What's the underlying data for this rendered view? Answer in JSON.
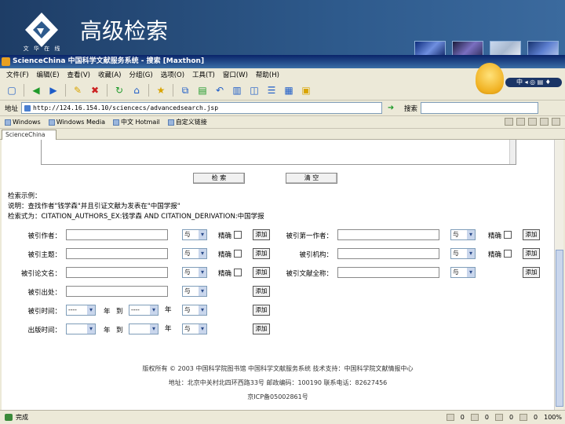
{
  "slide": {
    "title": "高级检索",
    "logo_caption": "文 华 在 线"
  },
  "browser": {
    "title": "ScienceChina 中国科学文献服务系统 - 搜索 [Maxthon]",
    "menu": [
      "文件(F)",
      "编辑(E)",
      "查看(V)",
      "收藏(A)",
      "分组(G)",
      "选项(O)",
      "工具(T)",
      "窗口(W)",
      "帮助(H)"
    ],
    "mascot_label": "中 ◂ ◎ ▤ ♦",
    "address_label": "地址",
    "address_url": "http://124.16.154.10/sciencecs/advancedsearch.jsp",
    "search_label": "搜索",
    "favorites": [
      "Windows",
      "Windows Media",
      "中文 Hotmail",
      "自定义链接"
    ],
    "tab_label": "ScienceChina"
  },
  "page": {
    "search_button": "检 索",
    "clear_button": "清 空",
    "examples_title": "检索示例：",
    "example_1": "说明：查找作者\"钱学森\"并且引证文献为发表在\"中国学报\"",
    "example_2": "检索式为：CITATION_AUTHORS_EX:钱学森 AND CITATION_DERIVATION:中国学报",
    "fields": [
      {
        "label": "被引作者：",
        "op": "与",
        "exact": "精确",
        "add": "添加"
      },
      {
        "label": "被引主题：",
        "op": "与",
        "exact": "精确",
        "add": "添加"
      },
      {
        "label": "被引论文名：",
        "op": "与",
        "exact": "精确",
        "add": "添加"
      },
      {
        "label": "被引出处：",
        "op": "与",
        "add": "添加"
      },
      {
        "label": "被引时间：",
        "op": "与",
        "add": "添加"
      },
      {
        "label": "出版时间：",
        "op": "与",
        "add": "添加"
      }
    ],
    "right_fields": [
      {
        "label": "被引第一作者：",
        "op": "与",
        "exact": "精确",
        "add": "添加"
      },
      {
        "label": "被引机构：",
        "op": "与",
        "exact": "精确",
        "add": "添加"
      },
      {
        "label": "被引文献全称：",
        "op": "与",
        "add": "添加"
      }
    ],
    "time_from": "----",
    "time_to": "----",
    "unit_year": "年",
    "unit_to": "到",
    "unit_year2": "年",
    "unit_pub_year": "年",
    "unit_pub_to": "到",
    "unit_pub_year2": "年",
    "footer_1": "版权所有 © 2003 中国科学院图书馆 中国科学文献服务系统 技术支持：中国科学院文献情报中心",
    "footer_2": "地址：北京中关村北四环西路33号 邮政编码：100190 联系电话：82627456",
    "footer_3": "京ICP备05002861号"
  },
  "status": {
    "left": "完成",
    "zoom": "100%",
    "items": [
      "0",
      "0",
      "0",
      "0"
    ]
  }
}
